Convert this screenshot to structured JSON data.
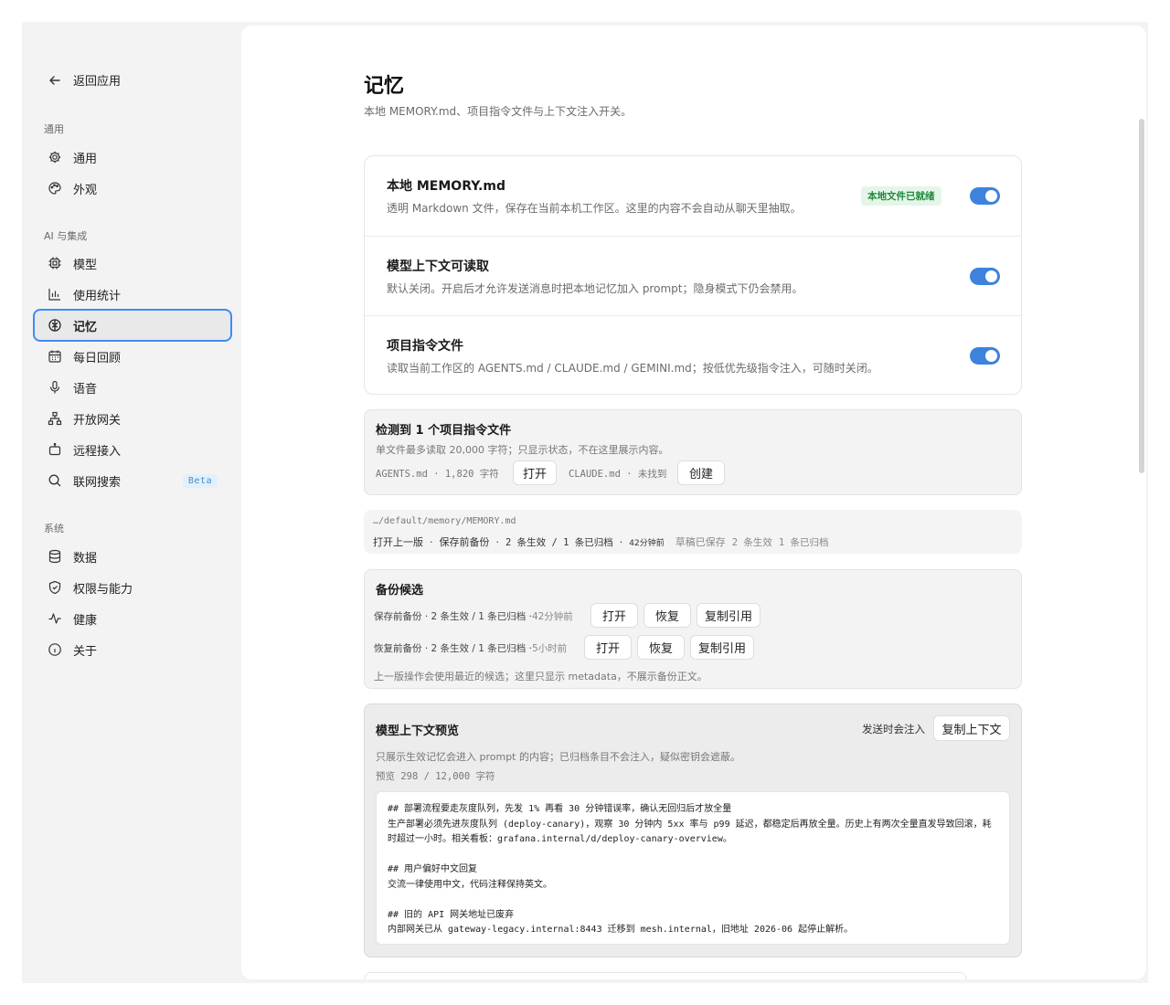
{
  "sidebar": {
    "back_label": "返回应用",
    "section_general": "通用",
    "section_ai": "AI 与集成",
    "section_system": "系统",
    "items": [
      {
        "label": "通用",
        "icon": "gear-icon"
      },
      {
        "label": "外观",
        "icon": "palette-icon"
      },
      {
        "label": "模型",
        "icon": "cpu-icon"
      },
      {
        "label": "使用统计",
        "icon": "bar-chart-icon"
      },
      {
        "label": "记忆",
        "icon": "brain-icon",
        "active": true
      },
      {
        "label": "每日回顾",
        "icon": "calendar-icon"
      },
      {
        "label": "语音",
        "icon": "microphone-icon"
      },
      {
        "label": "开放网关",
        "icon": "network-icon"
      },
      {
        "label": "远程接入",
        "icon": "bot-icon"
      },
      {
        "label": "联网搜索",
        "icon": "search-icon",
        "badge": "Beta"
      },
      {
        "label": "数据",
        "icon": "database-icon"
      },
      {
        "label": "权限与能力",
        "icon": "shield-icon"
      },
      {
        "label": "健康",
        "icon": "pulse-icon"
      },
      {
        "label": "关于",
        "icon": "info-icon"
      }
    ]
  },
  "page": {
    "title": "记忆",
    "subtitle": "本地 MEMORY.md、项目指令文件与上下文注入开关。"
  },
  "settings": [
    {
      "title": "本地 MEMORY.md",
      "desc": "透明 Markdown 文件，保存在当前本机工作区。这里的内容不会自动从聊天里抽取。",
      "badge": "本地文件已就绪",
      "enabled": true
    },
    {
      "title": "模型上下文可读取",
      "desc": "默认关闭。开启后才允许发送消息时把本地记忆加入 prompt；隐身模式下仍会禁用。",
      "enabled": true
    },
    {
      "title": "项目指令文件",
      "desc": "读取当前工作区的 AGENTS.md / CLAUDE.md / GEMINI.md；按低优先级指令注入，可随时关闭。",
      "enabled": true
    }
  ],
  "instruction_files": {
    "title": "检测到 1 个项目指令文件",
    "desc": "单文件最多读取 20,000 字符；只显示状态，不在这里展示内容。",
    "file1_info": "AGENTS.md · 1,820 字符",
    "file1_action": "打开",
    "file2_info": "CLAUDE.md · 未找到",
    "file2_action": "创建"
  },
  "memory_path": {
    "path": "…/default/memory/MEMORY.md",
    "action_prev": "打开上一版",
    "action_backup": "保存前备份",
    "backup_stats": "2 条生效 / 1 条已归档",
    "backup_age": "42分钟前",
    "draft_status": "草稿已保存",
    "draft_active": "2 条生效",
    "draft_archived": "1 条已归档"
  },
  "backups": {
    "title": "备份候选",
    "items": [
      {
        "label": "保存前备份 · 2 条生效 / 1 条已归档 · ",
        "age": "42分钟前",
        "open": "打开",
        "restore": "恢复",
        "copy": "复制引用"
      },
      {
        "label": "恢复前备份 · 2 条生效 / 1 条已归档 · ",
        "age": "5小时前",
        "open": "打开",
        "restore": "恢复",
        "copy": "复制引用"
      }
    ],
    "note": "上一版操作会使用最近的候选；这里只显示 metadata，不展示备份正文。"
  },
  "preview": {
    "title": "模型上下文预览",
    "inject_label": "发送时会注入",
    "copy_button": "复制上下文",
    "desc": "只展示生效记忆会进入 prompt 的内容；已归档条目不会注入，疑似密钥会遮蔽。",
    "count": "预览 298 / 12,000 字符",
    "content": "## 部署流程要走灰度队列，先发 1% 再看 30 分钟错误率，确认无回归后才放全量\n生产部署必须先进灰度队列 (deploy-canary)，观察 30 分钟内 5xx 率与 p99 延迟，都稳定后再放全量。历史上有两次全量直发导致回滚，耗时超过一小时。相关看板：grafana.internal/d/deploy-canary-overview。\n\n## 用户偏好中文回复\n交流一律使用中文，代码注释保持英文。\n\n## 旧的 API 网关地址已废弃\n内部网关已从 gateway-legacy.internal:8443 迁移到 mesh.internal，旧地址 2026-06 起停止解析。"
  }
}
